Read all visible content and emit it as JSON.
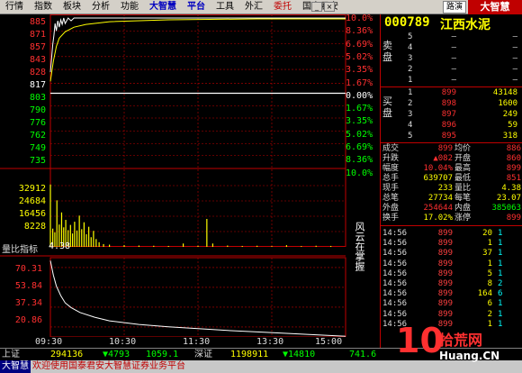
{
  "menu": {
    "items": [
      "行情",
      "指数",
      "板块",
      "分析",
      "功能",
      "大智慧",
      "平台",
      "工具",
      "外汇",
      "委托",
      "国泰君安"
    ],
    "route_label": "路演",
    "logo_text": "大智慧"
  },
  "stock": {
    "code": "000789",
    "name": "江西水泥"
  },
  "chart_data": {
    "type": "line",
    "title": "",
    "price_axis": [
      "885",
      "871",
      "857",
      "843",
      "828",
      "817",
      "803",
      "790",
      "776",
      "762",
      "749",
      "735"
    ],
    "price_axis_colors": [
      "#ff3030",
      "#ff3030",
      "#ff3030",
      "#ff3030",
      "#ff3030",
      "#ffffff",
      "#00ff00",
      "#00ff00",
      "#00ff00",
      "#00ff00",
      "#00ff00",
      "#00ff00"
    ],
    "pct_axis": [
      "10.0%",
      "8.36%",
      "6.69%",
      "5.02%",
      "3.35%",
      "1.67%",
      "0.00%",
      "1.67%",
      "3.35%",
      "5.02%",
      "6.69%",
      "8.36%",
      "10.0%"
    ],
    "pct_axis_colors": [
      "#ff3030",
      "#ff3030",
      "#ff3030",
      "#ff3030",
      "#ff3030",
      "#ff3030",
      "#ffffff",
      "#00ff00",
      "#00ff00",
      "#00ff00",
      "#00ff00",
      "#00ff00",
      "#00ff00"
    ],
    "prev_close": 817,
    "ylim": [
      735,
      899
    ],
    "volume_axis": [
      "32912",
      "24684",
      "16456",
      "8228"
    ],
    "volume_ylim": [
      0,
      41140
    ],
    "indicator_axis": [
      "70.31",
      "53.84",
      "37.34",
      "20.86"
    ],
    "indicator_ylim": [
      12.6,
      78.5
    ],
    "x_ticks": [
      "09:30",
      "10:30",
      "11:30",
      "13:30",
      "15:00"
    ],
    "x_ticks_frac": [
      0,
      0.25,
      0.5,
      0.75,
      1.0
    ],
    "price_series": [
      {
        "t": 0.0,
        "v": 840
      },
      {
        "t": 0.004,
        "v": 855
      },
      {
        "t": 0.008,
        "v": 870
      },
      {
        "t": 0.012,
        "v": 880
      },
      {
        "t": 0.016,
        "v": 893
      },
      {
        "t": 0.02,
        "v": 885
      },
      {
        "t": 0.025,
        "v": 896
      },
      {
        "t": 0.03,
        "v": 889
      },
      {
        "t": 0.035,
        "v": 897
      },
      {
        "t": 0.04,
        "v": 892
      },
      {
        "t": 0.045,
        "v": 899
      },
      {
        "t": 0.05,
        "v": 893
      },
      {
        "t": 0.06,
        "v": 899
      },
      {
        "t": 0.07,
        "v": 896
      },
      {
        "t": 0.08,
        "v": 899
      },
      {
        "t": 0.09,
        "v": 899
      },
      {
        "t": 0.12,
        "v": 899
      },
      {
        "t": 0.2,
        "v": 899
      },
      {
        "t": 0.4,
        "v": 899
      },
      {
        "t": 0.6,
        "v": 899
      },
      {
        "t": 0.8,
        "v": 899
      },
      {
        "t": 1.0,
        "v": 899
      }
    ],
    "avg_series": [
      {
        "t": 0.0,
        "v": 830
      },
      {
        "t": 0.01,
        "v": 852
      },
      {
        "t": 0.02,
        "v": 868
      },
      {
        "t": 0.03,
        "v": 877
      },
      {
        "t": 0.05,
        "v": 884
      },
      {
        "t": 0.08,
        "v": 889
      },
      {
        "t": 0.12,
        "v": 892
      },
      {
        "t": 0.2,
        "v": 895
      },
      {
        "t": 0.4,
        "v": 897
      },
      {
        "t": 0.7,
        "v": 898
      },
      {
        "t": 1.0,
        "v": 898
      }
    ],
    "volume_bars": [
      {
        "t": 0.0,
        "v": 33500
      },
      {
        "t": 0.008,
        "v": 9800
      },
      {
        "t": 0.015,
        "v": 7800
      },
      {
        "t": 0.022,
        "v": 25000
      },
      {
        "t": 0.03,
        "v": 12000
      },
      {
        "t": 0.038,
        "v": 18500
      },
      {
        "t": 0.045,
        "v": 10500
      },
      {
        "t": 0.052,
        "v": 14500
      },
      {
        "t": 0.06,
        "v": 9000
      },
      {
        "t": 0.068,
        "v": 11800
      },
      {
        "t": 0.075,
        "v": 7200
      },
      {
        "t": 0.082,
        "v": 13500
      },
      {
        "t": 0.09,
        "v": 8800
      },
      {
        "t": 0.098,
        "v": 16800
      },
      {
        "t": 0.106,
        "v": 9500
      },
      {
        "t": 0.114,
        "v": 13200
      },
      {
        "t": 0.122,
        "v": 6800
      },
      {
        "t": 0.13,
        "v": 10800
      },
      {
        "t": 0.138,
        "v": 5200
      },
      {
        "t": 0.146,
        "v": 8600
      },
      {
        "t": 0.155,
        "v": 4200
      },
      {
        "t": 0.165,
        "v": 2500
      },
      {
        "t": 0.18,
        "v": 1500
      },
      {
        "t": 0.2,
        "v": 1200
      },
      {
        "t": 0.25,
        "v": 900
      },
      {
        "t": 0.3,
        "v": 700
      },
      {
        "t": 0.35,
        "v": 600
      },
      {
        "t": 0.4,
        "v": 500
      },
      {
        "t": 0.45,
        "v": 1800
      },
      {
        "t": 0.5,
        "v": 600
      },
      {
        "t": 0.53,
        "v": 15000
      },
      {
        "t": 0.55,
        "v": 1800
      },
      {
        "t": 0.6,
        "v": 700
      },
      {
        "t": 0.65,
        "v": 500
      },
      {
        "t": 0.7,
        "v": 600
      },
      {
        "t": 0.75,
        "v": 400
      },
      {
        "t": 0.8,
        "v": 900
      },
      {
        "t": 0.85,
        "v": 400
      },
      {
        "t": 0.9,
        "v": 600
      },
      {
        "t": 0.95,
        "v": 500
      }
    ],
    "indicator_series": [
      {
        "t": 0.0,
        "v": 76
      },
      {
        "t": 0.01,
        "v": 64
      },
      {
        "t": 0.02,
        "v": 55
      },
      {
        "t": 0.035,
        "v": 47
      },
      {
        "t": 0.05,
        "v": 41
      },
      {
        "t": 0.07,
        "v": 37
      },
      {
        "t": 0.1,
        "v": 33
      },
      {
        "t": 0.15,
        "v": 29
      },
      {
        "t": 0.2,
        "v": 26
      },
      {
        "t": 0.3,
        "v": 23
      },
      {
        "t": 0.4,
        "v": 21
      },
      {
        "t": 0.5,
        "v": 19.5
      },
      {
        "t": 0.6,
        "v": 18
      },
      {
        "t": 0.7,
        "v": 16.8
      },
      {
        "t": 0.8,
        "v": 15.6
      },
      {
        "t": 0.9,
        "v": 14.4
      },
      {
        "t": 1.0,
        "v": 13.2
      }
    ]
  },
  "indicator": {
    "label": "量比指标",
    "value": "4.38"
  },
  "sidebar_vertical": "风云在掌握",
  "orderbook": {
    "sell_label": "卖盘",
    "buy_label": "买盘",
    "sell": [
      {
        "lv": "5",
        "px": "—",
        "vol": "—"
      },
      {
        "lv": "4",
        "px": "—",
        "vol": "—"
      },
      {
        "lv": "3",
        "px": "—",
        "vol": "—"
      },
      {
        "lv": "2",
        "px": "—",
        "vol": "—"
      },
      {
        "lv": "1",
        "px": "—",
        "vol": "—"
      }
    ],
    "buy": [
      {
        "lv": "1",
        "px": "899",
        "vol": "43148"
      },
      {
        "lv": "2",
        "px": "898",
        "vol": "1600"
      },
      {
        "lv": "3",
        "px": "897",
        "vol": "249"
      },
      {
        "lv": "4",
        "px": "896",
        "vol": "59"
      },
      {
        "lv": "5",
        "px": "895",
        "vol": "318"
      }
    ]
  },
  "stats": [
    {
      "k1": "成交",
      "v1": "899",
      "c1": "#ff3030",
      "k2": "均价",
      "v2": "886",
      "c2": "#ff3030"
    },
    {
      "k1": "升跌",
      "v1": "▲082",
      "c1": "#ff3030",
      "k2": "开盘",
      "v2": "860",
      "c2": "#ff3030"
    },
    {
      "k1": "幅度",
      "v1": "10.04%",
      "c1": "#ff3030",
      "k2": "最高",
      "v2": "899",
      "c2": "#ff3030"
    },
    {
      "k1": "总手",
      "v1": "639707",
      "c1": "#ffff00",
      "k2": "最低",
      "v2": "851",
      "c2": "#ff3030"
    },
    {
      "k1": "现手",
      "v1": "233",
      "c1": "#ffff00",
      "k2": "量比",
      "v2": "4.38",
      "c2": "#ffff00"
    },
    {
      "k1": "总笔",
      "v1": "27734",
      "c1": "#ffff00",
      "k2": "每笔",
      "v2": "23.07",
      "c2": "#ffff00"
    },
    {
      "k1": "外盘",
      "v1": "254644",
      "c1": "#ff3030",
      "k2": "内盘",
      "v2": "385063",
      "c2": "#00ff00"
    },
    {
      "k1": "换手",
      "v1": "17.02%",
      "c1": "#ffff00",
      "k2": "涨停",
      "v2": "899",
      "c2": "#ff3030"
    }
  ],
  "ticks": [
    {
      "t": "14:56",
      "p": "899",
      "v": "20",
      "d": "1"
    },
    {
      "t": "14:56",
      "p": "899",
      "v": "1",
      "d": "1"
    },
    {
      "t": "14:56",
      "p": "899",
      "v": "37",
      "d": "1"
    },
    {
      "t": "14:56",
      "p": "899",
      "v": "1",
      "d": "1"
    },
    {
      "t": "14:56",
      "p": "899",
      "v": "5",
      "d": "1"
    },
    {
      "t": "14:56",
      "p": "899",
      "v": "8",
      "d": "2"
    },
    {
      "t": "14:56",
      "p": "899",
      "v": "164",
      "d": "6"
    },
    {
      "t": "14:56",
      "p": "899",
      "v": "6",
      "d": "1"
    },
    {
      "t": "14:56",
      "p": "899",
      "v": "2",
      "d": "1"
    },
    {
      "t": "14:56",
      "p": "899",
      "v": "1",
      "d": "1"
    }
  ],
  "statusbar": {
    "sh_label": "上证",
    "sh_vol": "294136",
    "sh_chg": "▼4793",
    "sh_idx": "1059.1",
    "sz_label": "深证",
    "sz_vol": "1198911",
    "sz_chg": "▼14810",
    "sz_idx": "741.6"
  },
  "message": {
    "label": "大智慧",
    "text": "欢迎使用国泰君安大智慧证券业务平台"
  },
  "watermark": {
    "big": "10",
    "cn": "拾荒网",
    "url": "Huang.CN"
  }
}
